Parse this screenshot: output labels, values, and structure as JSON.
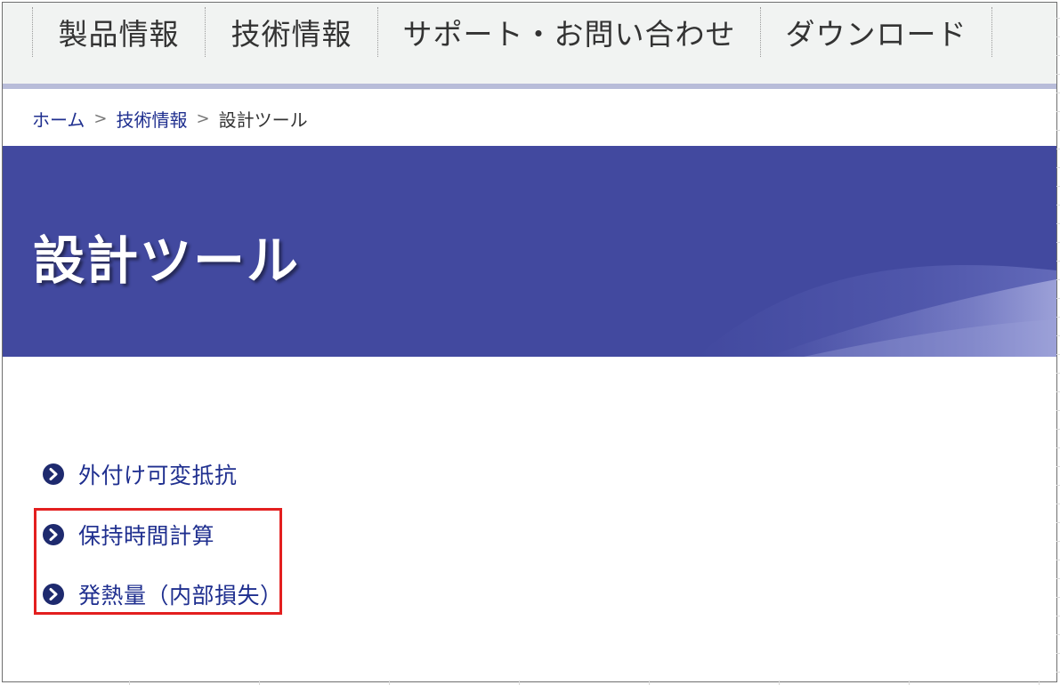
{
  "nav": {
    "items": [
      {
        "label": "製品情報"
      },
      {
        "label": "技術情報"
      },
      {
        "label": "サポート・お問い合わせ"
      },
      {
        "label": "ダウンロード"
      }
    ]
  },
  "breadcrumb": {
    "home": "ホーム",
    "separator": ">",
    "section": "技術情報",
    "current": "設計ツール"
  },
  "banner": {
    "title": "設計ツール"
  },
  "tools": {
    "items": [
      {
        "label": "外付け可変抵抗",
        "icon": "chevron-right-circle-icon"
      },
      {
        "label": "保持時間計算",
        "icon": "chevron-right-circle-icon"
      },
      {
        "label": "発熱量（内部損失）",
        "icon": "chevron-right-circle-icon"
      }
    ]
  },
  "colors": {
    "nav_background": "#f1f3f2",
    "nav_underline": "#b8bcd9",
    "link": "#1f2f8f",
    "banner_background": "#42499f",
    "highlight": "#e31f1f",
    "icon": "#1e2a6e"
  }
}
